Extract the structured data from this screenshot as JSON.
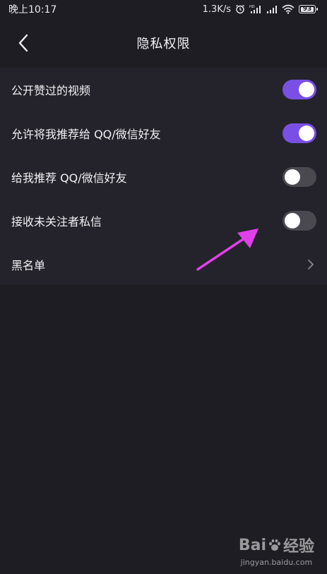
{
  "status_bar": {
    "time": "晚上10:17",
    "network_speed": "1.3K/s",
    "battery": "93"
  },
  "header": {
    "title": "隐私权限"
  },
  "settings": {
    "items": [
      {
        "label": "公开赞过的视频",
        "type": "toggle",
        "on": true
      },
      {
        "label": "允许将我推荐给 QQ/微信好友",
        "type": "toggle",
        "on": true
      },
      {
        "label": "给我推荐 QQ/微信好友",
        "type": "toggle",
        "on": false
      },
      {
        "label": "接收未关注者私信",
        "type": "toggle",
        "on": false
      },
      {
        "label": "黑名单",
        "type": "link"
      }
    ]
  },
  "colors": {
    "background": "#1e1d24",
    "panel": "#24232b",
    "toggle_on": "#7a4fe6",
    "toggle_off": "#4a4950",
    "annotation_arrow": "#e040e8"
  },
  "watermark": {
    "logo": "Bai百度经验",
    "logo_brand": "Bai",
    "logo_text": "经验",
    "url": "jingyan.baidu.com"
  }
}
